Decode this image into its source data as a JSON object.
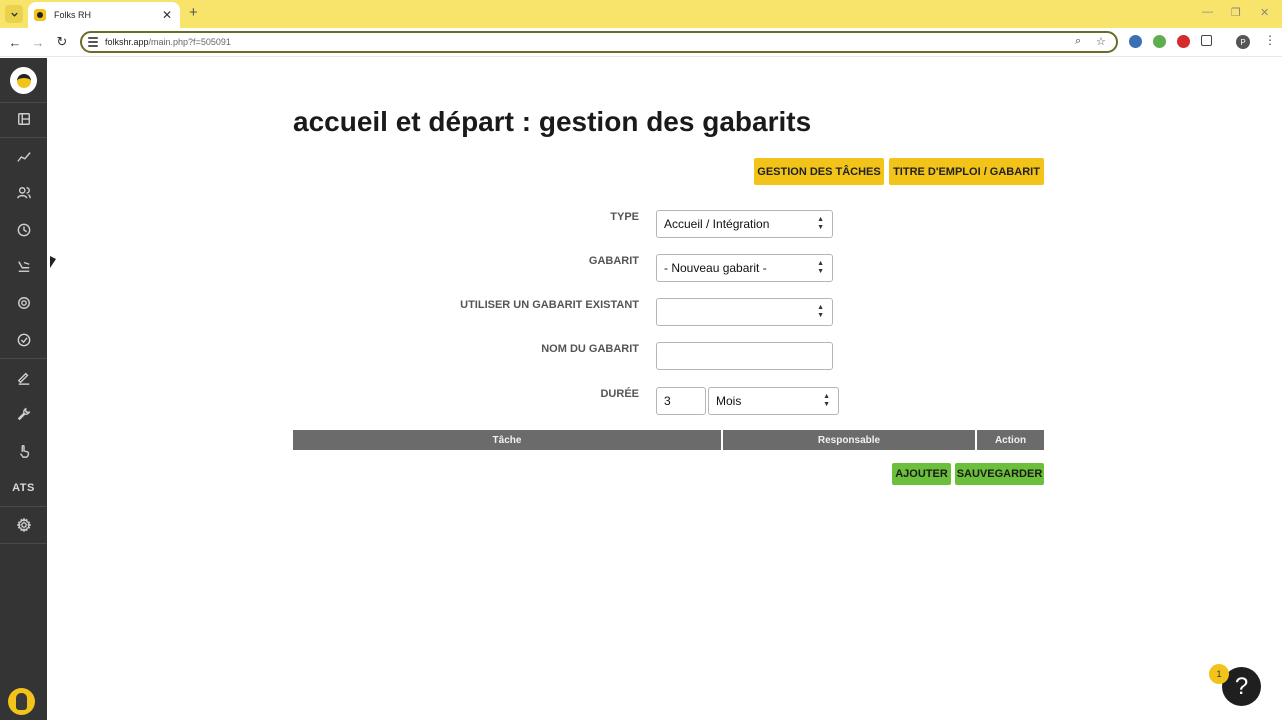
{
  "browser": {
    "tab_title": "Folks RH",
    "tab_close": "✕",
    "new_tab": "+",
    "url_host": "folkshr.app",
    "url_path": "/main.php?f=505091",
    "profile_initial": "P",
    "colors": {
      "tab_strip": "#f8e46a",
      "omnibox_border": "#6b6b2a"
    }
  },
  "sidebar": {
    "items": [
      {
        "icon": "dashboard-icon"
      },
      {
        "icon": "analytics-icon"
      },
      {
        "icon": "employees-icon"
      },
      {
        "icon": "time-icon"
      },
      {
        "icon": "vacation-icon"
      },
      {
        "icon": "settings-cog-icon"
      },
      {
        "icon": "tasks-check-icon"
      },
      {
        "icon": "signature-icon"
      },
      {
        "icon": "tools-icon"
      },
      {
        "icon": "hand-icon"
      },
      {
        "label": "ATS"
      },
      {
        "icon": "settings-icon"
      }
    ],
    "colors": {
      "background": "#343434"
    }
  },
  "page": {
    "title": "accueil et départ : gestion des gabarits",
    "buttons": {
      "tasks": "Gestion des tâches",
      "job_title": "Titre d'emploi / gabarit",
      "add": "Ajouter",
      "save": "Sauvegarder"
    },
    "form": {
      "type_label": "Type",
      "type_value": "Accueil / Intégration",
      "template_label": "Gabarit",
      "template_value": "- Nouveau gabarit -",
      "existing_label": "Utiliser un gabarit existant",
      "existing_value": "",
      "name_label": "Nom du gabarit",
      "name_value": "",
      "duration_label": "Durée",
      "duration_value": "3",
      "duration_unit": "Mois"
    },
    "table": {
      "columns": [
        "Tâche",
        "Responsable",
        "Action"
      ]
    },
    "help_badge": "1",
    "help_icon": "?",
    "colors": {
      "accent_yellow": "#f2c318",
      "accent_green": "#6cbf3b",
      "table_header": "#6b6b6b"
    }
  }
}
